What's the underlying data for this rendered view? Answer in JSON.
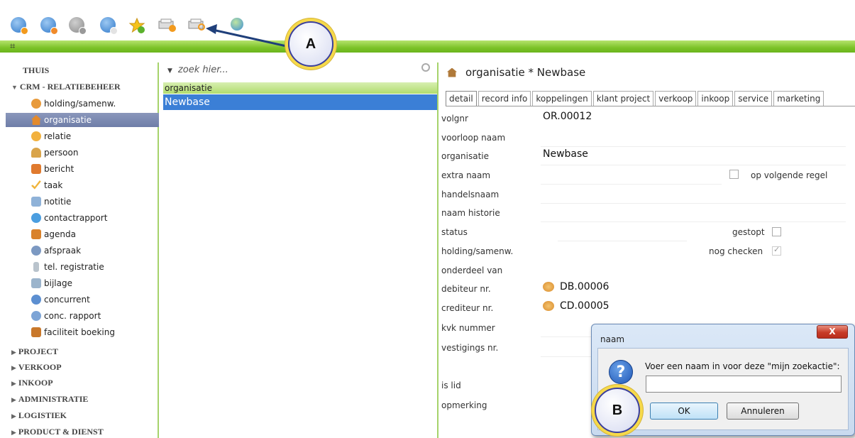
{
  "toolbar": {
    "icons": [
      "globe-add-icon",
      "globe-refresh-icon",
      "globe-disabled-icon",
      "globe-user-icon",
      "star-add-icon",
      "save-search-icon",
      "open-search-icon",
      "refresh-icon"
    ]
  },
  "nav": {
    "sections": [
      {
        "label": "THUIS"
      },
      {
        "label": "CRM - RELATIEBEHEER",
        "expanded": true
      },
      {
        "label": "PROJECT"
      },
      {
        "label": "VERKOOP"
      },
      {
        "label": "INKOOP"
      },
      {
        "label": "ADMINISTRATIE"
      },
      {
        "label": "LOGISTIEK"
      },
      {
        "label": "PRODUCT & DIENST"
      }
    ],
    "crm_items": [
      "holding/samenw.",
      "organisatie",
      "relatie",
      "persoon",
      "bericht",
      "taak",
      "notitie",
      "contactrapport",
      "agenda",
      "afspraak",
      "tel. registratie",
      "bijlage",
      "concurrent",
      "conc. rapport",
      "faciliteit boeking"
    ],
    "active_item": "organisatie"
  },
  "list": {
    "search_placeholder": "zoek hier...",
    "header": "organisatie",
    "selected_row": "Newbase"
  },
  "detail": {
    "title": "organisatie * Newbase",
    "tabs": [
      "detail",
      "record info",
      "koppelingen",
      "klant project",
      "verkoop",
      "inkoop",
      "service",
      "marketing"
    ],
    "fields": {
      "volgnr": {
        "label": "volgnr",
        "value": "OR.00012"
      },
      "voorloop_naam": {
        "label": "voorloop naam",
        "value": ""
      },
      "organisatie": {
        "label": "organisatie",
        "value": "Newbase"
      },
      "extra_naam": {
        "label": "extra naam",
        "value": ""
      },
      "op_volgende_regel": {
        "label": "op volgende regel",
        "checked": false
      },
      "handelsnaam": {
        "label": "handelsnaam",
        "value": ""
      },
      "naam_historie": {
        "label": "naam historie",
        "value": ""
      },
      "status": {
        "label": "status",
        "value": ""
      },
      "gestopt": {
        "label": "gestopt",
        "checked": false
      },
      "holding": {
        "label": "holding/samenw.",
        "value": ""
      },
      "nog_checken": {
        "label": "nog checken",
        "checked": true
      },
      "onderdeel_van": {
        "label": "onderdeel van",
        "value": ""
      },
      "debiteur": {
        "label": "debiteur nr.",
        "value": "DB.00006"
      },
      "crediteur": {
        "label": "crediteur nr.",
        "value": "CD.00005"
      },
      "kvk": {
        "label": "kvk nummer",
        "value": ""
      },
      "vestigings": {
        "label": "vestigings nr.",
        "value": ""
      },
      "is_lid": {
        "label": "is lid",
        "value": ""
      },
      "opmerking": {
        "label": "opmerking",
        "value": ""
      }
    }
  },
  "dialog": {
    "title": "naam",
    "close": "X",
    "message": "Voer een naam in voor deze \"mijn zoekactie\":",
    "input_value": "",
    "ok": "OK",
    "cancel": "Annuleren"
  },
  "callouts": {
    "a": "A",
    "b": "B"
  },
  "colors": {
    "accent_green": "#7cc328",
    "selection_blue": "#3b7fd6",
    "nav_active": "#7584ad",
    "callout_ring": "#f6d94a"
  }
}
